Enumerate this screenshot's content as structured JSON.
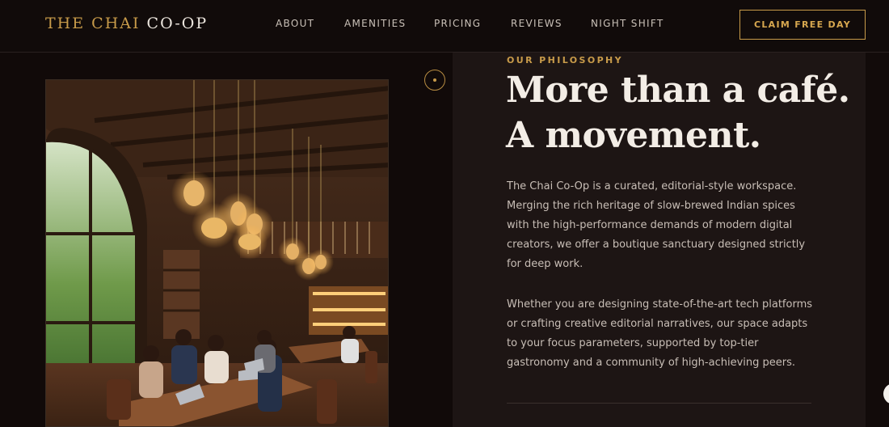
{
  "brand": {
    "name_accent": "THE CHAI",
    "name_rest": "CO-OP"
  },
  "nav": {
    "links": [
      "ABOUT",
      "AMENITIES",
      "PRICING",
      "REVIEWS",
      "NIGHT SHIFT"
    ],
    "cta_label": "CLAIM FREE DAY"
  },
  "hero": {
    "eyebrow": "OUR PHILOSOPHY",
    "headline_line1": "More than a café.",
    "headline_line2": "A movement.",
    "paragraph1": "The Chai Co-Op is a curated, editorial-style workspace. Merging the rich heritage of slow-brewed Indian spices with the high-performance demands of modern digital creators, we offer a boutique sanctuary designed strictly for deep work.",
    "paragraph2": "Whether you are designing state-of-the-art tech platforms or crafting creative editorial narratives, our space adapts to your focus parameters, supported by top-tier gastronomy and a community of high-achieving peers."
  },
  "icons": {
    "scroll_indicator": "scroll-dot-icon",
    "chat_bubble": "chat-bubble-icon"
  },
  "colors": {
    "accent_gold": "#c89b4a",
    "background": "#120b0a",
    "card": "#1d1514",
    "headline": "#f3ede6",
    "body_text": "#c8beb6"
  }
}
